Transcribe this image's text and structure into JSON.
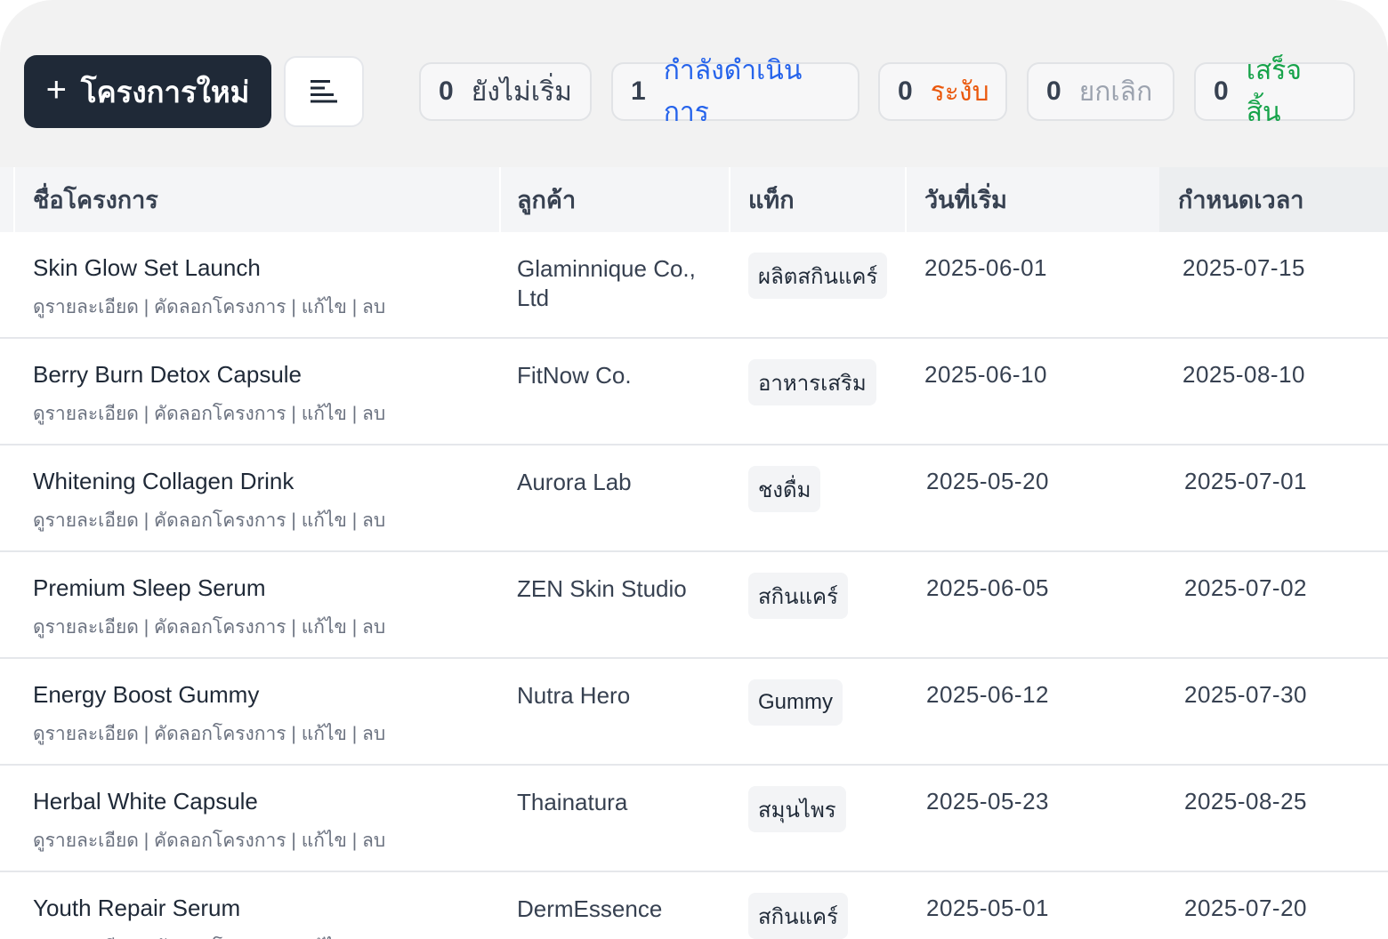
{
  "toolbar": {
    "new_project_label": "โครงการใหม่",
    "plus_icon": "plus-icon",
    "sort_icon": "align-left-icon"
  },
  "status_chips": [
    {
      "count": "0",
      "label": "ยังไม่เริ่ม",
      "color": "#374151"
    },
    {
      "count": "1",
      "label": "กำลังดำเนินการ",
      "color": "#2563eb"
    },
    {
      "count": "0",
      "label": "ระงับ",
      "color": "#ea580c"
    },
    {
      "count": "0",
      "label": "ยกเลิก",
      "color": "#9ca3af"
    },
    {
      "count": "0",
      "label": "เสร็จสิ้น",
      "color": "#16a34a"
    }
  ],
  "table": {
    "columns": [
      "ชื่อโครงการ",
      "ลูกค้า",
      "แท็ก",
      "วันที่เริ่ม",
      "กำหนดเวลา"
    ],
    "actions": {
      "view": "ดูรายละเอียด",
      "copy": "คัดลอกโครงการ",
      "edit": "แก้ไข",
      "delete": "ลบ",
      "separator": " | "
    },
    "rows": [
      {
        "name": "Skin Glow Set Launch",
        "client": "Glaminnique Co., Ltd",
        "tag": "ผลิตสกินแคร์",
        "start": "2025-06-01",
        "due": "2025-07-15"
      },
      {
        "name": "Berry Burn Detox Capsule",
        "client": "FitNow Co.",
        "tag": "อาหารเสริม",
        "start": "2025-06-10",
        "due": "2025-08-10"
      },
      {
        "name": "Whitening Collagen Drink",
        "client": "Aurora Lab",
        "tag": "ชงดื่ม",
        "start": "2025-05-20",
        "due": "2025-07-01"
      },
      {
        "name": "Premium Sleep Serum",
        "client": "ZEN Skin Studio",
        "tag": "สกินแคร์",
        "start": "2025-06-05",
        "due": "2025-07-02"
      },
      {
        "name": "Energy Boost Gummy",
        "client": "Nutra Hero",
        "tag": "Gummy",
        "start": "2025-06-12",
        "due": "2025-07-30"
      },
      {
        "name": "Herbal White Capsule",
        "client": "Thainatura",
        "tag": "สมุนไพร",
        "start": "2025-05-23",
        "due": "2025-08-25"
      },
      {
        "name": "Youth Repair Serum",
        "client": "DermEssence",
        "tag": "สกินแคร์",
        "start": "2025-05-01",
        "due": "2025-07-20"
      }
    ]
  }
}
